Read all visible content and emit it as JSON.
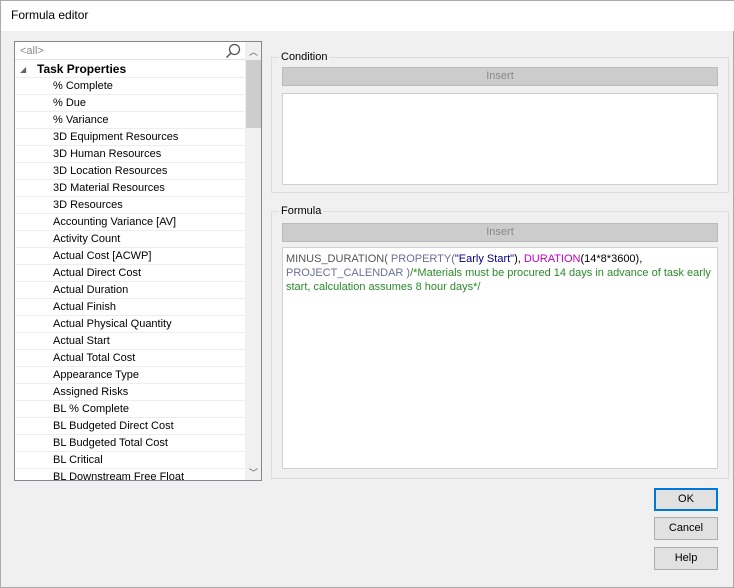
{
  "window": {
    "title": "Formula editor"
  },
  "list": {
    "search_placeholder": "<all>",
    "group": "Task Properties",
    "items": [
      "% Complete",
      "% Due",
      "% Variance",
      "3D Equipment Resources",
      "3D Human Resources",
      "3D Location Resources",
      "3D Material Resources",
      "3D Resources",
      "Accounting Variance [AV]",
      "Activity Count",
      "Actual Cost [ACWP]",
      "Actual Direct Cost",
      "Actual Duration",
      "Actual Finish",
      "Actual Physical Quantity",
      "Actual Start",
      "Actual Total Cost",
      "Appearance Type",
      "Assigned Risks",
      "BL % Complete",
      "BL Budgeted Direct Cost",
      "BL Budgeted Total Cost",
      "BL Critical",
      "BL Downstream Free Float"
    ]
  },
  "condition": {
    "label": "Condition",
    "insert": "Insert",
    "text": ""
  },
  "formula": {
    "label": "Formula",
    "insert": "Insert",
    "code": {
      "p1": "MINUS_DURATION( ",
      "p2": "PROPERTY(",
      "p3": "\"Early Start\"",
      "p4": "), ",
      "p5": "DURATION",
      "p6": "(14*8*3600),",
      "p7": "PROJECT_CALENDAR )",
      "p8": "/*Materials must be procured 14 days in advance of task early start, calculation assumes 8 hour days*/"
    }
  },
  "buttons": {
    "ok": "OK",
    "cancel": "Cancel",
    "help": "Help"
  }
}
